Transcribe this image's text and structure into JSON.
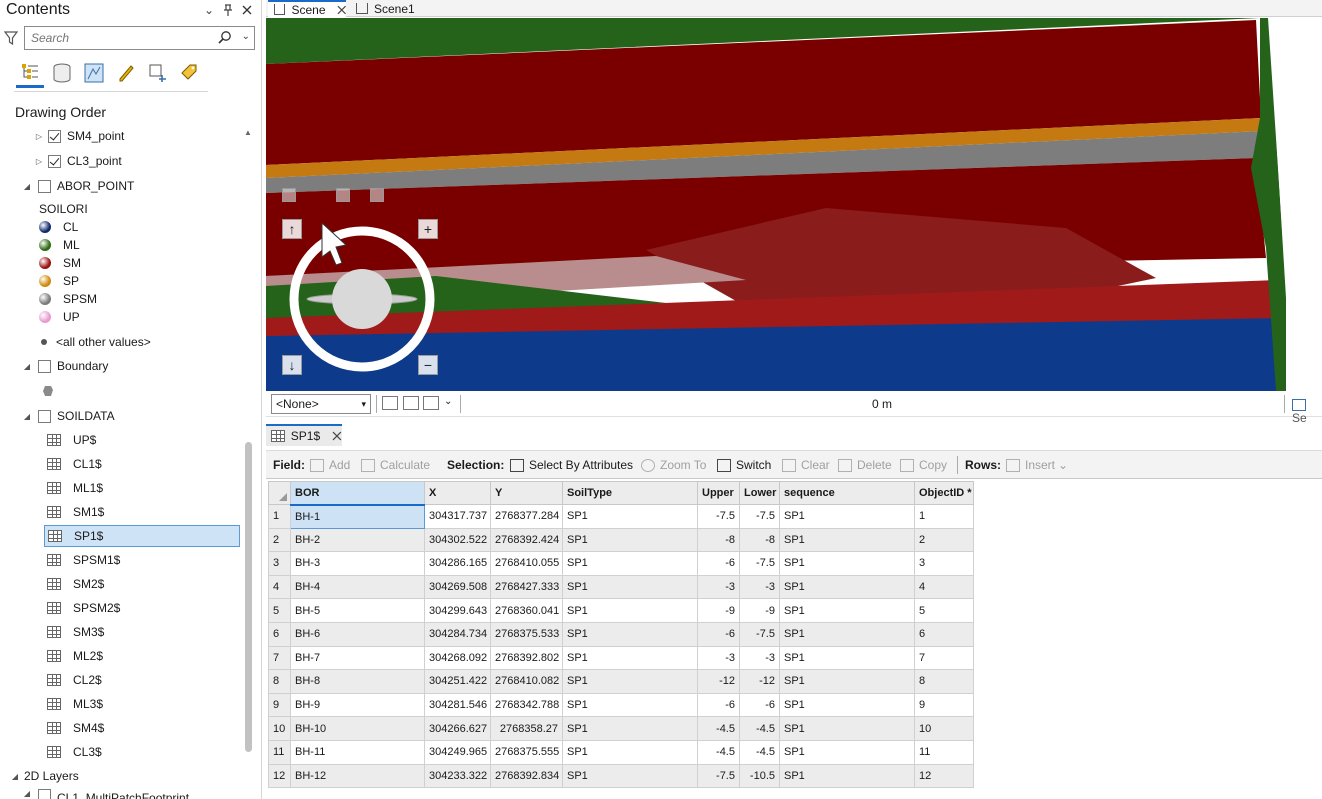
{
  "contents": {
    "title": "Contents",
    "search_placeholder": "Search",
    "drawing_order": "Drawing Order",
    "layers": {
      "sm4_point": "SM4_point",
      "cl3_point": "CL3_point",
      "abor_point": "ABOR_POINT",
      "soilori": "SOILORI",
      "legend": [
        {
          "label": "CL",
          "color": "#0e2a6b"
        },
        {
          "label": "ML",
          "color": "#2a6b12"
        },
        {
          "label": "SM",
          "color": "#9b1010"
        },
        {
          "label": "SP",
          "color": "#d08a0a"
        },
        {
          "label": "SPSM",
          "color": "#7a7a7a"
        },
        {
          "label": "UP",
          "color": "#e89ad0"
        }
      ],
      "all_other": "<all other values>",
      "boundary": "Boundary",
      "soildata": "SOILDATA",
      "tables": [
        "UP$",
        "CL1$",
        "ML1$",
        "SM1$",
        "SP1$",
        "SPSM1$",
        "SM2$",
        "SPSM2$",
        "SM3$",
        "ML2$",
        "CL2$",
        "ML3$",
        "SM4$",
        "CL3$"
      ],
      "selected_table": "SP1$",
      "layers_2d": "2D Layers",
      "cut_off": "CL1_MultiPatchFootprint"
    }
  },
  "scene_tabs": [
    {
      "label": "Scene",
      "active": true
    },
    {
      "label": "Scene1",
      "active": false
    }
  ],
  "mapbar": {
    "selection_value": "<None>",
    "scale": "0 m",
    "right_cut": "Se"
  },
  "table_tab": {
    "label": "SP1$"
  },
  "toolbar": {
    "field_label": "Field:",
    "add": "Add",
    "calculate": "Calculate",
    "selection_label": "Selection:",
    "select_by_attributes": "Select By Attributes",
    "zoom_to": "Zoom To",
    "switch": "Switch",
    "clear": "Clear",
    "delete": "Delete",
    "copy": "Copy",
    "rows_label": "Rows:",
    "insert": "Insert"
  },
  "table": {
    "columns": [
      "BOR",
      "X",
      "Y",
      "SoilType",
      "Upper",
      "Lower",
      "sequence",
      "ObjectID *"
    ],
    "rows": [
      [
        "1",
        "BH-1",
        "304317.737",
        "2768377.284",
        "SP1",
        "-7.5",
        "-7.5",
        "SP1",
        "1"
      ],
      [
        "2",
        "BH-2",
        "304302.522",
        "2768392.424",
        "SP1",
        "-8",
        "-8",
        "SP1",
        "2"
      ],
      [
        "3",
        "BH-3",
        "304286.165",
        "2768410.055",
        "SP1",
        "-6",
        "-7.5",
        "SP1",
        "3"
      ],
      [
        "4",
        "BH-4",
        "304269.508",
        "2768427.333",
        "SP1",
        "-3",
        "-3",
        "SP1",
        "4"
      ],
      [
        "5",
        "BH-5",
        "304299.643",
        "2768360.041",
        "SP1",
        "-9",
        "-9",
        "SP1",
        "5"
      ],
      [
        "6",
        "BH-6",
        "304284.734",
        "2768375.533",
        "SP1",
        "-6",
        "-7.5",
        "SP1",
        "6"
      ],
      [
        "7",
        "BH-7",
        "304268.092",
        "2768392.802",
        "SP1",
        "-3",
        "-3",
        "SP1",
        "7"
      ],
      [
        "8",
        "BH-8",
        "304251.422",
        "2768410.082",
        "SP1",
        "-12",
        "-12",
        "SP1",
        "8"
      ],
      [
        "9",
        "BH-9",
        "304281.546",
        "2768342.788",
        "SP1",
        "-6",
        "-6",
        "SP1",
        "9"
      ],
      [
        "10",
        "BH-10",
        "304266.627",
        "2768358.27",
        "SP1",
        "-4.5",
        "-4.5",
        "SP1",
        "10"
      ],
      [
        "11",
        "BH-11",
        "304249.965",
        "2768375.555",
        "SP1",
        "-4.5",
        "-4.5",
        "SP1",
        "11"
      ],
      [
        "12",
        "BH-12",
        "304233.322",
        "2768392.834",
        "SP1",
        "-7.5",
        "-10.5",
        "SP1",
        "12"
      ]
    ]
  },
  "colors": {
    "accent": "#1b6ac9",
    "selection": "#cde2f5"
  }
}
